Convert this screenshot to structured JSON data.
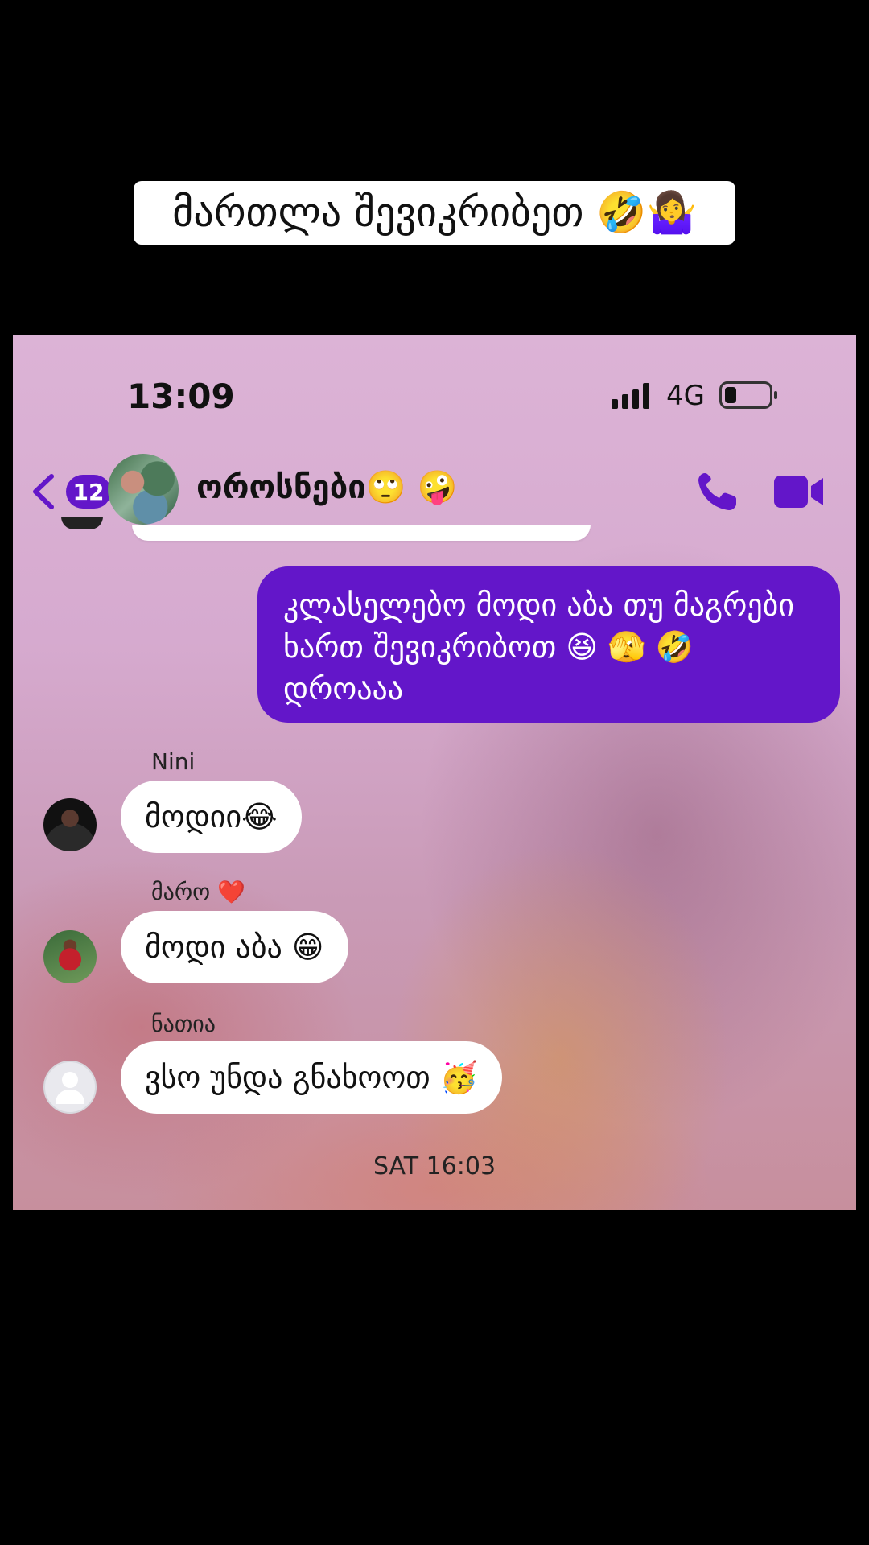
{
  "caption": {
    "text": "მართლა შევიკრიბეთ 🤣🤷‍♀️"
  },
  "status_bar": {
    "time": "13:09",
    "network": "4G"
  },
  "header": {
    "back_badge": "12",
    "title": "ოროსნები🙄 🤪"
  },
  "messages": [
    {
      "direction": "outgoing",
      "text": "კლასელებო მოდი აბა თუ მაგრები ხართ შევიკრიბოთ 😆 🫣 🤣 დროააა"
    },
    {
      "direction": "incoming",
      "sender": "Nini",
      "text": "მოდიი😂"
    },
    {
      "direction": "incoming",
      "sender": "მარო ❤️",
      "text": "მოდი აბა 😁"
    },
    {
      "direction": "incoming",
      "sender": "ნათია",
      "text": "ვსო უნდა გნახოოთ 🥳"
    }
  ],
  "timestamp": "SAT 16:03",
  "colors": {
    "accent": "#6316c9",
    "bubble_in": "#ffffff",
    "background": "#dcb3d6"
  },
  "icons": [
    "chevron-left-icon",
    "phone-icon",
    "video-camera-icon",
    "signal-icon",
    "battery-icon"
  ]
}
